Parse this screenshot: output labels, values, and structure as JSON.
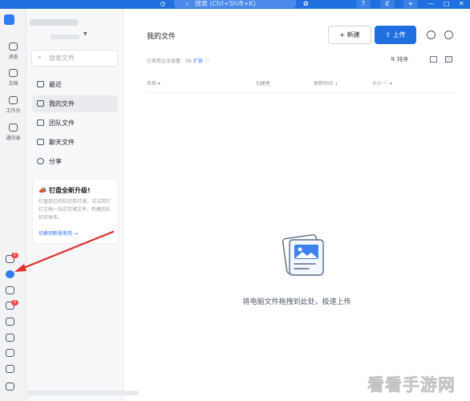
{
  "topbar": {
    "search_placeholder": "搜索 (Ctrl+Shift+K)",
    "help": "?"
  },
  "rail": {
    "items": [
      {
        "label": "消息",
        "icon": "message-icon"
      },
      {
        "label": "文档",
        "icon": "document-icon"
      },
      {
        "label": "工作台",
        "icon": "workbench-icon"
      },
      {
        "label": "通讯录",
        "icon": "contacts-icon"
      }
    ],
    "badges": {
      "phone": "1",
      "mail": "3"
    }
  },
  "sidebar": {
    "search_placeholder": "搜索文件",
    "nav": [
      {
        "label": "最近",
        "icon": "home-icon"
      },
      {
        "label": "我的文件",
        "icon": "my-files-icon"
      },
      {
        "label": "团队文件",
        "icon": "team-files-icon"
      },
      {
        "label": "聊天文件",
        "icon": "chat-files-icon"
      },
      {
        "label": "分享",
        "icon": "share-icon"
      }
    ],
    "promo": {
      "title": "钉盘全新升级!",
      "text": "钉盘现已和知识库打通，试试用钉钉文档一站式存储文件、构建团队知识体系。",
      "link": "切换到新版使用 →"
    }
  },
  "main": {
    "title": "我的文件",
    "new_button": "+ 新建",
    "upload_button": "上传",
    "usage_prefix": "已使用企业容量：",
    "usage_value": "0B",
    "usage_link": "扩容",
    "sort_label": "排序",
    "columns": [
      "名称",
      "创建者",
      "更新时间",
      "大小"
    ],
    "empty_text": "将电脑文件拖拽到此处，极速上传"
  },
  "watermark": "看看手游网",
  "colors": {
    "accent": "#1f6fe0",
    "link": "#3370ff",
    "badge": "#f54a45",
    "arrow": "#e0322b"
  }
}
